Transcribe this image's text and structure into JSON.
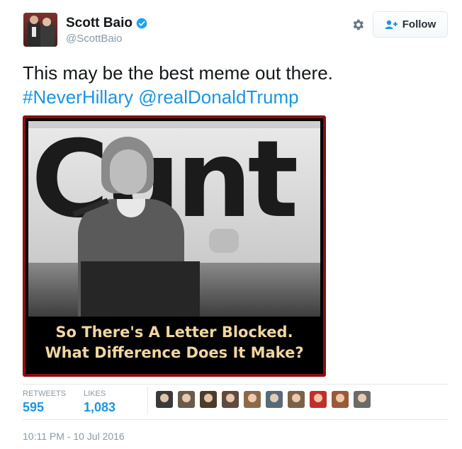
{
  "user": {
    "name": "Scott Baio",
    "handle": "@ScottBaio",
    "verified": true
  },
  "actions": {
    "follow_label": "Follow"
  },
  "tweet": {
    "text_plain": "This may be the best meme out there.",
    "hashtag": "#NeverHillary",
    "mention": "@realDonaldTrump"
  },
  "media": {
    "banner_text": "Cunt",
    "caption_line1": "So There's A Letter Blocked.",
    "caption_line2": "What Difference Does It Make?"
  },
  "stats": {
    "retweets_label": "RETWEETS",
    "retweets_value": "595",
    "likes_label": "LIKES",
    "likes_value": "1,083"
  },
  "likers": [
    {
      "color": "#3a3a3a"
    },
    {
      "color": "#6b5a4a"
    },
    {
      "color": "#4b3b2b"
    },
    {
      "color": "#5e4b3c"
    },
    {
      "color": "#8a6a4a"
    },
    {
      "color": "#556b7a"
    },
    {
      "color": "#7a6248"
    },
    {
      "color": "#c0302a"
    },
    {
      "color": "#9a5a3a"
    },
    {
      "color": "#6a6a6a"
    }
  ],
  "timestamp": "10:11 PM - 10 Jul 2016",
  "colors": {
    "link": "#1b95e0",
    "muted": "#8899a6",
    "border": "#e1e8ed",
    "media_frame": "#8c0c12"
  }
}
